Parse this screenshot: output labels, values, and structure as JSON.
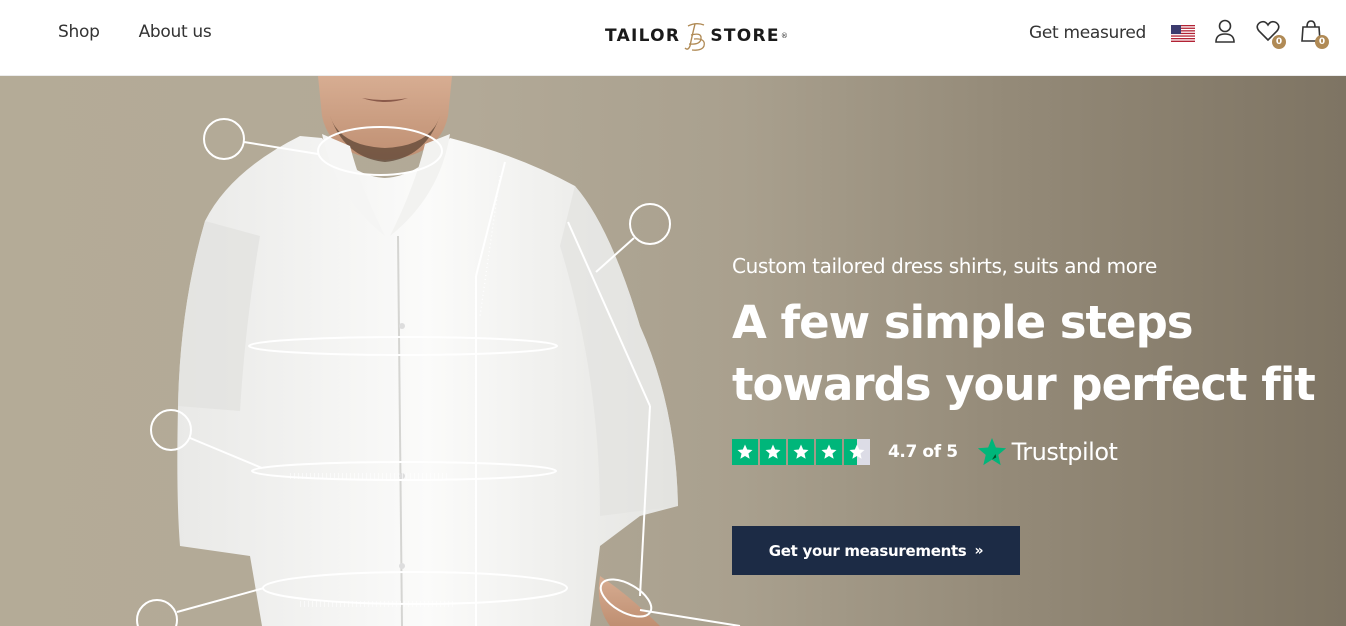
{
  "header": {
    "nav_left": [
      {
        "label": "Shop"
      },
      {
        "label": "About us"
      }
    ],
    "logo": {
      "left": "TAILOR",
      "right": "STORE",
      "mark": "®"
    },
    "get_measured": "Get measured",
    "flag_icon": "us-flag-icon",
    "wishlist_count": "0",
    "cart_count": "0"
  },
  "hero": {
    "subtitle": "Custom tailored dress shirts, suits and more",
    "headline_line1": "A few simple steps",
    "headline_line2": "towards your perfect fit",
    "rating": {
      "stars": 4.5,
      "score_text": "4.7 of 5",
      "brand": "Trustpilot"
    },
    "cta_label": "Get your measurements",
    "cta_chevron": "»"
  },
  "colors": {
    "accent": "#b08a55",
    "cta_bg": "#1c2b45",
    "trustpilot_green": "#00b67a"
  }
}
